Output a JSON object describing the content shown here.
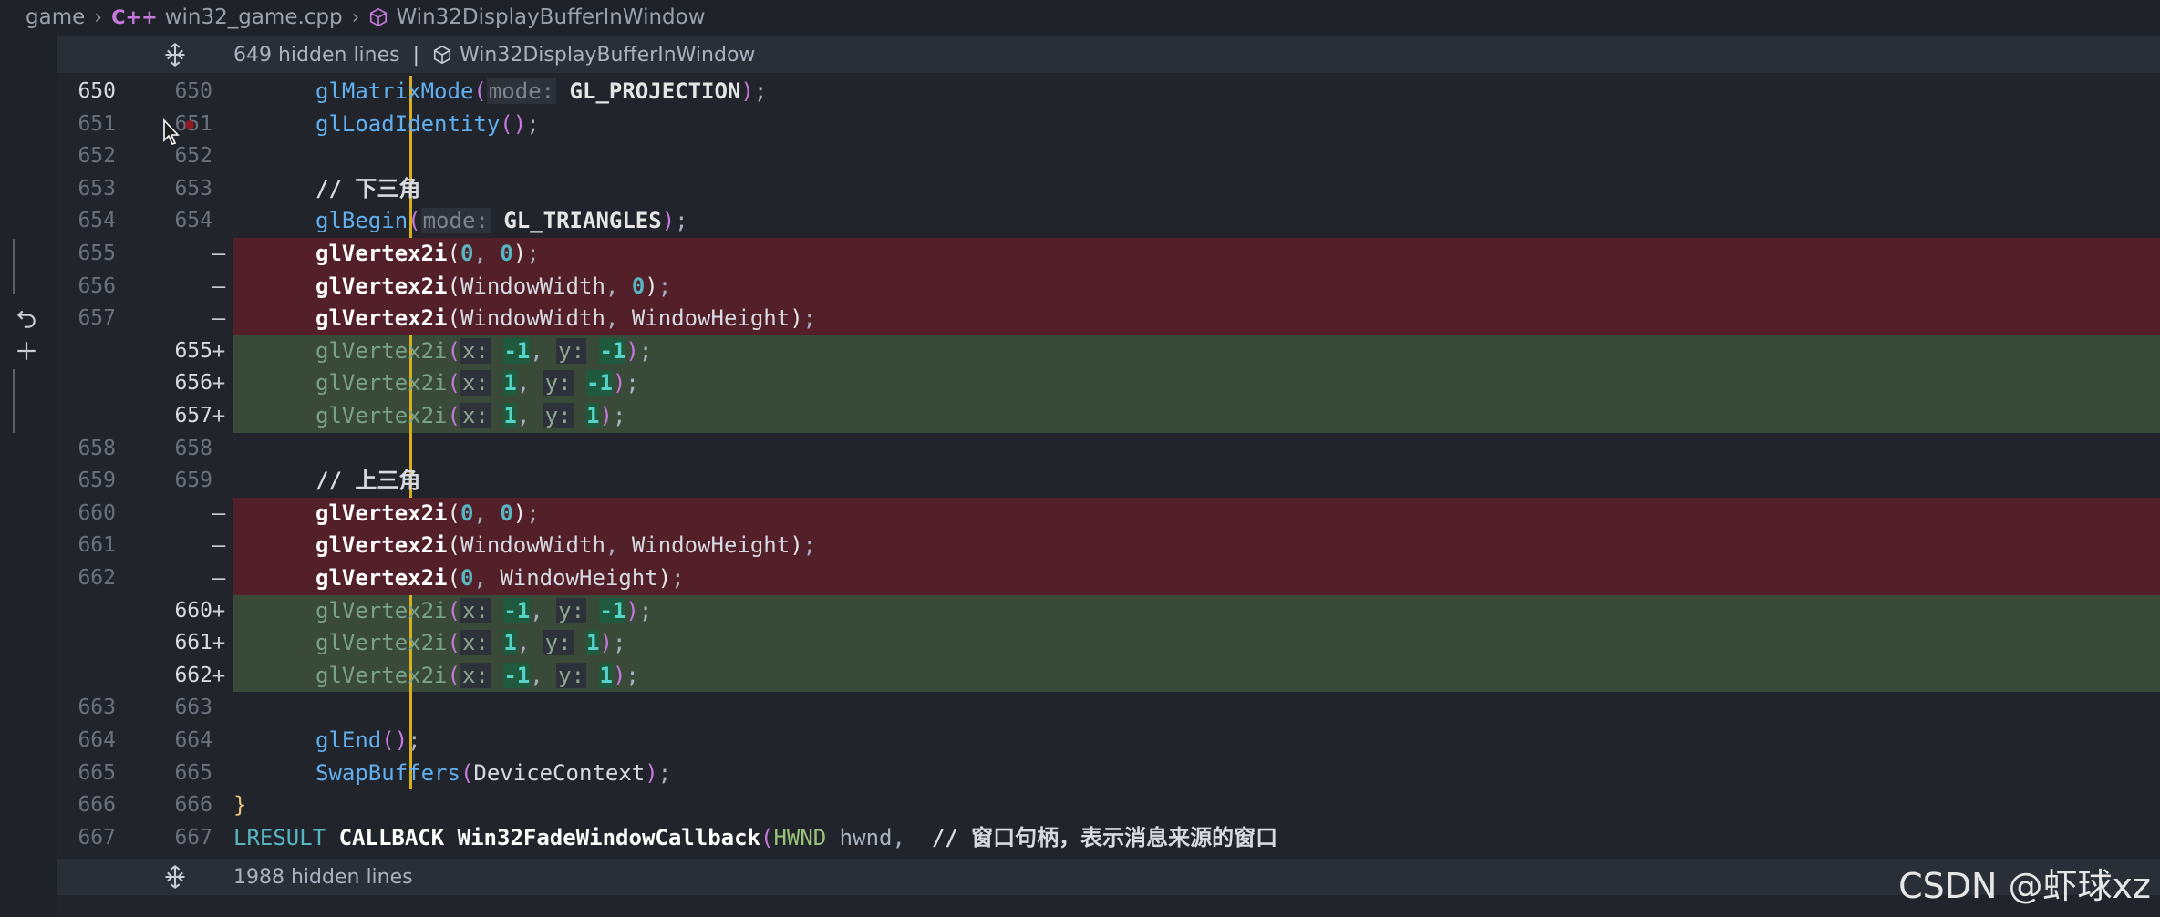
{
  "breadcrumb": {
    "items": [
      "game",
      "win32_game.cpp",
      "Win32DisplayBufferInWindow"
    ],
    "cpp_icon": "C++"
  },
  "folds": {
    "top": {
      "count_text": "649 hidden lines",
      "pipe": "|",
      "symbol": "Win32DisplayBufferInWindow"
    },
    "bottom": {
      "count_text": "1988 hidden lines"
    }
  },
  "lines": [
    {
      "old": "650",
      "new": "650",
      "type": "context",
      "text": "glMatrixMode(mode: GL_PROJECTION);"
    },
    {
      "old": "651",
      "new": "651",
      "type": "context",
      "text": "glLoadIdentity();"
    },
    {
      "old": "652",
      "new": "652",
      "type": "context",
      "text": ""
    },
    {
      "old": "653",
      "new": "653",
      "type": "context",
      "text": "// 下三角"
    },
    {
      "old": "654",
      "new": "654",
      "type": "context",
      "text": "glBegin(mode: GL_TRIANGLES);"
    },
    {
      "old": "655",
      "new": "",
      "marker": "—",
      "type": "deleted",
      "text": "glVertex2i(0, 0);"
    },
    {
      "old": "656",
      "new": "",
      "marker": "—",
      "type": "deleted",
      "text": "glVertex2i(WindowWidth, 0);"
    },
    {
      "old": "657",
      "new": "",
      "marker": "—",
      "type": "deleted",
      "text": "glVertex2i(WindowWidth, WindowHeight);"
    },
    {
      "old": "",
      "new": "655",
      "marker": "+",
      "type": "added",
      "text": "glVertex2i(x: -1, y: -1);"
    },
    {
      "old": "",
      "new": "656",
      "marker": "+",
      "type": "added",
      "text": "glVertex2i(x: 1, y: -1);"
    },
    {
      "old": "",
      "new": "657",
      "marker": "+",
      "type": "added",
      "text": "glVertex2i(x: 1, y: 1);"
    },
    {
      "old": "658",
      "new": "658",
      "type": "context",
      "text": ""
    },
    {
      "old": "659",
      "new": "659",
      "type": "context",
      "text": "// 上三角"
    },
    {
      "old": "660",
      "new": "",
      "marker": "—",
      "type": "deleted",
      "text": "glVertex2i(0, 0);"
    },
    {
      "old": "661",
      "new": "",
      "marker": "—",
      "type": "deleted",
      "text": "glVertex2i(WindowWidth, WindowHeight);"
    },
    {
      "old": "662",
      "new": "",
      "marker": "—",
      "type": "deleted",
      "text": "glVertex2i(0, WindowHeight);"
    },
    {
      "old": "",
      "new": "660",
      "marker": "+",
      "type": "added",
      "text": "glVertex2i(x: -1, y: -1);"
    },
    {
      "old": "",
      "new": "661",
      "marker": "+",
      "type": "added",
      "text": "glVertex2i(x: 1, y: 1);"
    },
    {
      "old": "",
      "new": "662",
      "marker": "+",
      "type": "added",
      "text": "glVertex2i(x: -1, y: 1);"
    },
    {
      "old": "663",
      "new": "663",
      "type": "context",
      "text": ""
    },
    {
      "old": "664",
      "new": "664",
      "type": "context",
      "text": "glEnd();"
    },
    {
      "old": "665",
      "new": "665",
      "type": "context",
      "text": "SwapBuffers(DeviceContext);"
    },
    {
      "old": "666",
      "new": "666",
      "type": "context",
      "text": "}"
    },
    {
      "old": "667",
      "new": "667",
      "type": "context",
      "text": "LRESULT CALLBACK Win32FadeWindowCallback(HWND hwnd,  // 窗口句柄，表示消息来源的窗口"
    }
  ],
  "watermark": "CSDN @虾球xz",
  "colors": {
    "deleted_bg": "#532029",
    "added_bg": "#3a4a38",
    "guide": "#d8ae1f",
    "editor_bg": "#21252b"
  }
}
